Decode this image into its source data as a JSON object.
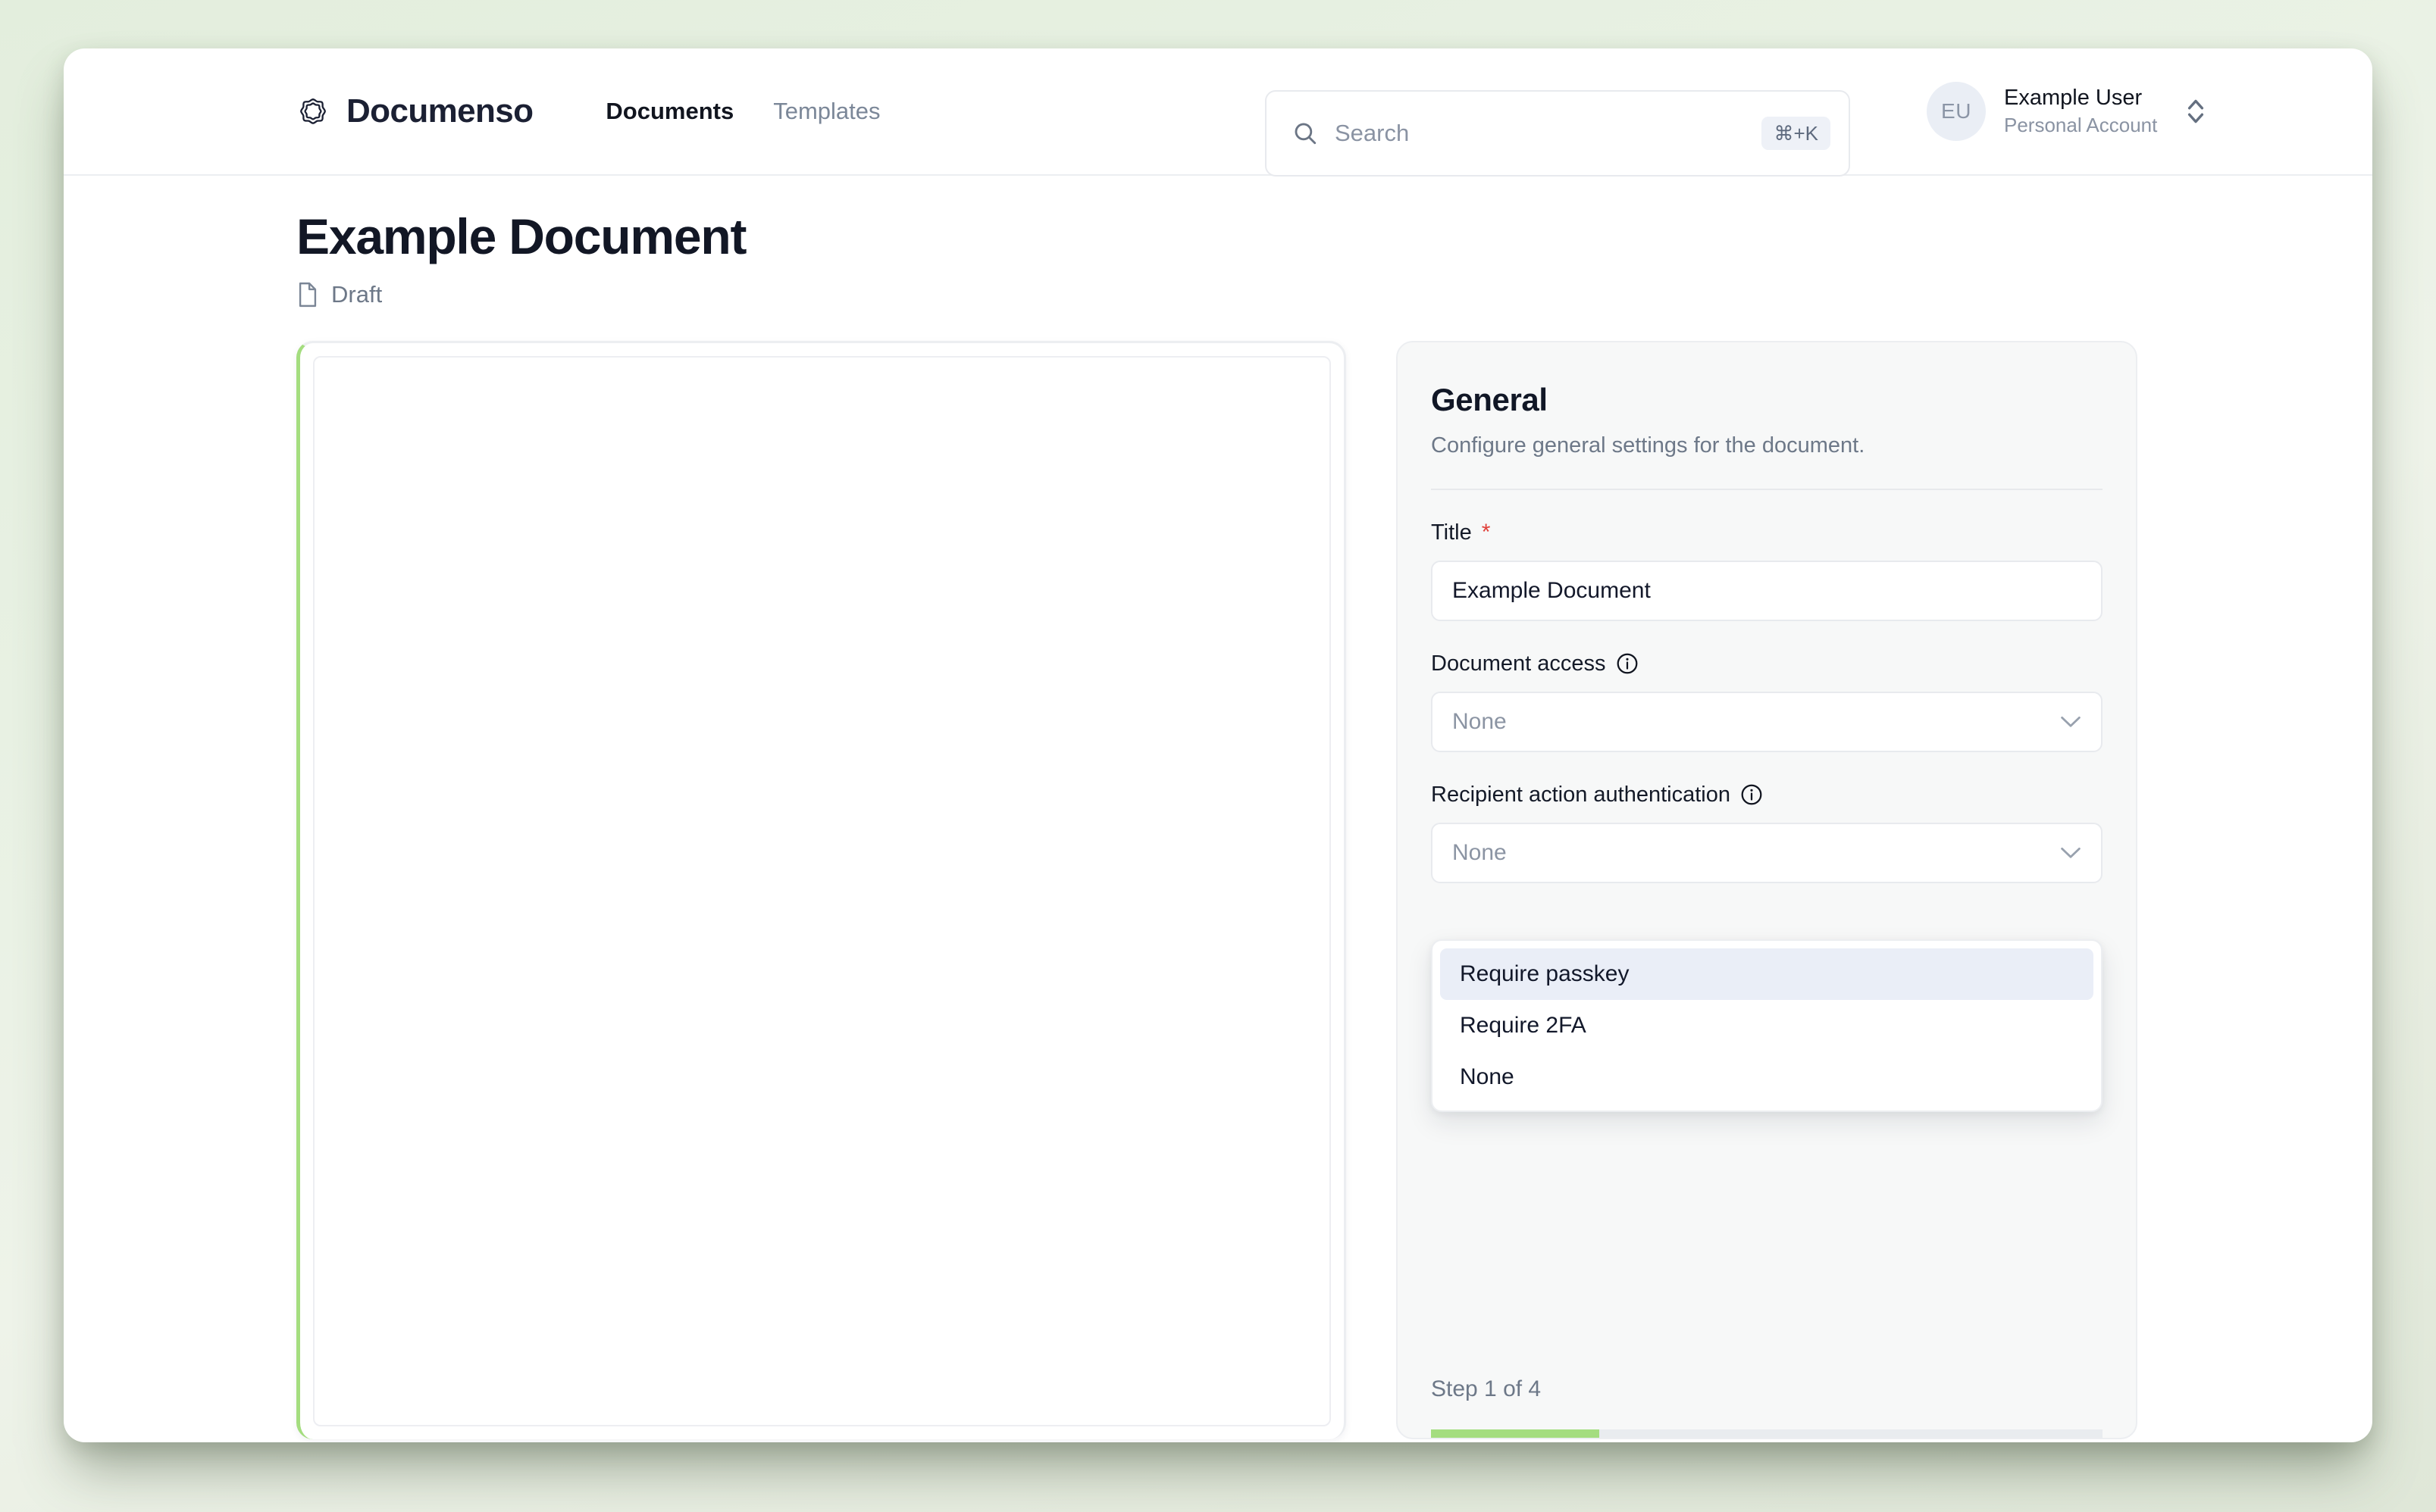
{
  "brand": {
    "name": "Documenso",
    "logo_icon": "documenso-scalloped-logo-icon"
  },
  "nav": {
    "items": [
      {
        "label": "Documents",
        "active": true
      },
      {
        "label": "Templates",
        "active": false
      }
    ]
  },
  "search": {
    "placeholder": "Search",
    "shortcut": "⌘+K",
    "icon": "search-icon"
  },
  "account": {
    "initials": "EU",
    "name": "Example User",
    "subtitle": "Personal Account",
    "caret_icon": "chevron-up-down-icon"
  },
  "page": {
    "title": "Example Document",
    "status": "Draft",
    "status_icon": "file-icon"
  },
  "document_preview": {
    "accent_color": "#a4dd7f"
  },
  "settings": {
    "title": "General",
    "description": "Configure general settings for the document.",
    "fields": {
      "title": {
        "label": "Title",
        "required_mark": "*",
        "value": "Example Document"
      },
      "document_access": {
        "label": "Document access",
        "info_icon": "info-circle-icon",
        "value": "None",
        "chevron_icon": "chevron-down-icon"
      },
      "recipient_action_authentication": {
        "label": "Recipient action authentication",
        "info_icon": "info-circle-icon",
        "value": "None",
        "chevron_icon": "chevron-down-icon"
      }
    },
    "dropdown": {
      "open": true,
      "options": [
        {
          "label": "Require passkey",
          "highlighted": true
        },
        {
          "label": "Require 2FA",
          "highlighted": false
        },
        {
          "label": "None",
          "highlighted": false
        }
      ]
    },
    "footer": {
      "step_label": "Step 1 of 4",
      "progress_percent": 25,
      "progress_color": "#a4dd7f"
    }
  }
}
